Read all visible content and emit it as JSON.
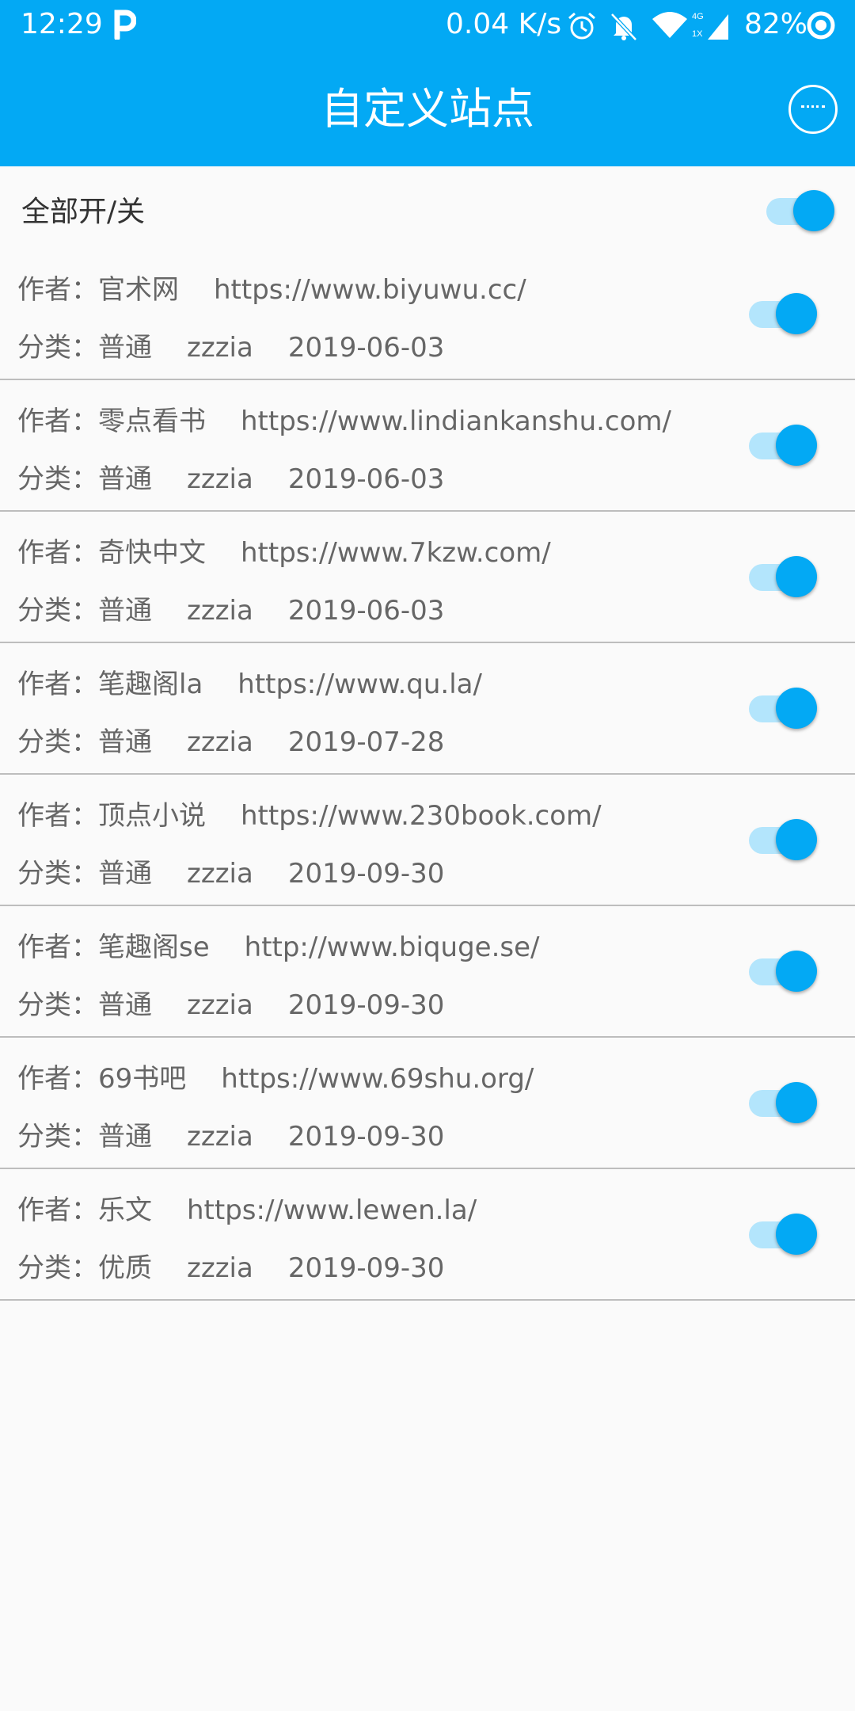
{
  "status_bar": {
    "time": "12:29",
    "net_speed": "0.04 K/s",
    "battery": "82%",
    "icons": [
      "p-app-icon",
      "alarm-icon",
      "bell-off-icon",
      "wifi-icon",
      "signal-icon",
      "ring-icon"
    ]
  },
  "header": {
    "title": "自定义站点",
    "more_icon": "more-horizontal-circle-icon"
  },
  "toggle_all": {
    "label": "全部开/关",
    "on": true
  },
  "sites": [
    {
      "author_label": "作者：",
      "author": "官术网",
      "url": "https://www.biyuwu.cc/",
      "category_label": "分类：",
      "category": "普通",
      "user": "zzzia",
      "date": "2019-06-03",
      "enabled": true
    },
    {
      "author_label": "作者：",
      "author": "零点看书",
      "url": "https://www.lindiankanshu.com/",
      "category_label": "分类：",
      "category": "普通",
      "user": "zzzia",
      "date": "2019-06-03",
      "enabled": true
    },
    {
      "author_label": "作者：",
      "author": "奇快中文",
      "url": "https://www.7kzw.com/",
      "category_label": "分类：",
      "category": "普通",
      "user": "zzzia",
      "date": "2019-06-03",
      "enabled": true
    },
    {
      "author_label": "作者：",
      "author": "笔趣阁la",
      "url": "https://www.qu.la/",
      "category_label": "分类：",
      "category": "普通",
      "user": "zzzia",
      "date": "2019-07-28",
      "enabled": true
    },
    {
      "author_label": "作者：",
      "author": "顶点小说",
      "url": "https://www.230book.com/",
      "category_label": "分类：",
      "category": "普通",
      "user": "zzzia",
      "date": "2019-09-30",
      "enabled": true
    },
    {
      "author_label": "作者：",
      "author": "笔趣阁se",
      "url": "http://www.biquge.se/",
      "category_label": "分类：",
      "category": "普通",
      "user": "zzzia",
      "date": "2019-09-30",
      "enabled": true
    },
    {
      "author_label": "作者：",
      "author": "69书吧",
      "url": "https://www.69shu.org/",
      "category_label": "分类：",
      "category": "普通",
      "user": "zzzia",
      "date": "2019-09-30",
      "enabled": true
    },
    {
      "author_label": "作者：",
      "author": "乐文",
      "url": "https://www.lewen.la/",
      "category_label": "分类：",
      "category": "优质",
      "user": "zzzia",
      "date": "2019-09-30",
      "enabled": true
    }
  ],
  "colors": {
    "primary": "#03a9f4",
    "switch_track": "#b3e5fc",
    "divider": "#bdbdbd",
    "text_secondary": "#666666",
    "background": "#fafafa"
  }
}
